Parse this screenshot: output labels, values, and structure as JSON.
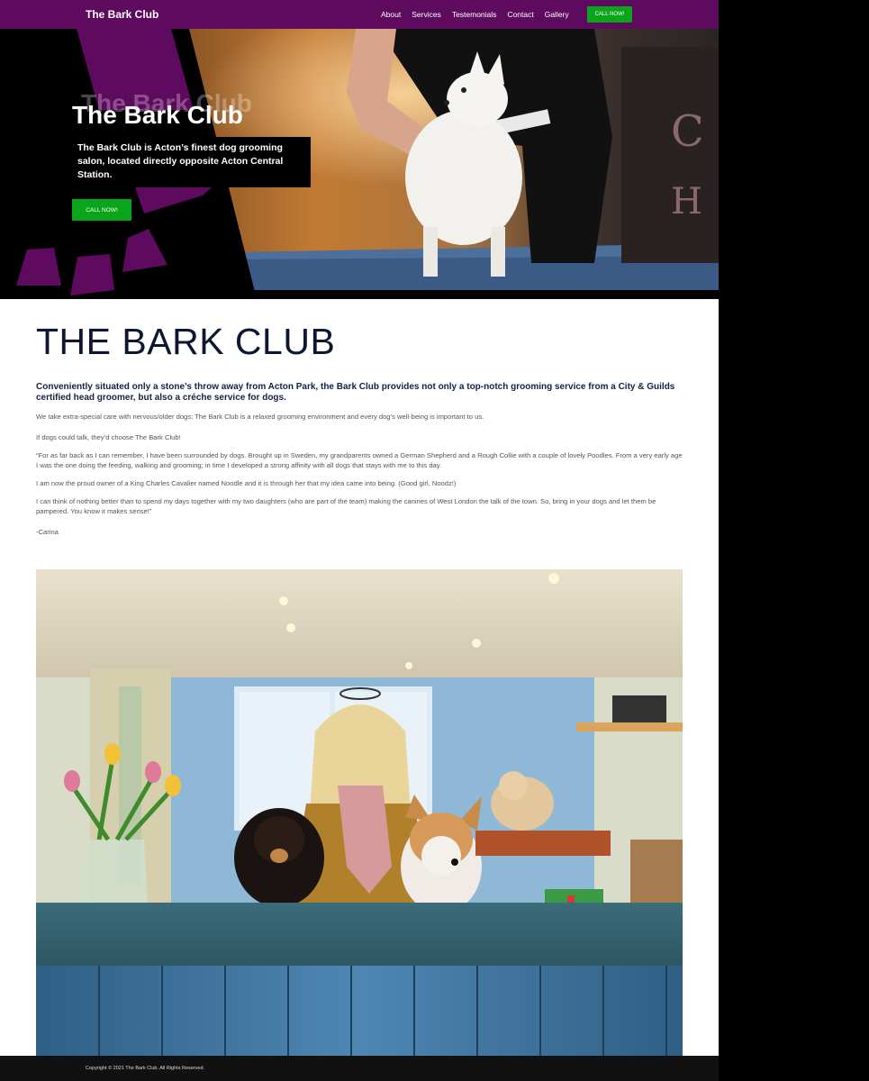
{
  "nav": {
    "brand": "The Bark Club",
    "links": [
      "About",
      "Services",
      "Testemonials",
      "Contact",
      "Gallery"
    ],
    "cta": "CALL NOW!"
  },
  "hero": {
    "title": "The Bark Club",
    "description": "The Bark Club is Acton’s finest dog grooming salon, located directly opposite Acton Central Station.",
    "cta": "CALL NOW!"
  },
  "main": {
    "heading": "THE BARK CLUB",
    "lead": "Conveniently situated only a stone’s throw away from Acton Park, the Bark Club provides not only a top-notch grooming service from a City & Guilds certified head groomer, but also a créche service for dogs.",
    "paragraphs": [
      "We take extra-special care with nervous/older dogs; The Bark Club is a relaxed grooming environment and every dog’s well-being is important to us.",
      "If dogs could talk, they’d choose The Bark Club!",
      "“For as far back as I can remember, I have been surrounded by dogs. Brought up in Sweden, my grandparents owned a German Shepherd and a Rough Collie with a couple of lovely Poodles. From a very early age I was the one doing the feeding, walking and grooming; in time I developed a strong affinity with all dogs that stays with me to this day.",
      "I am now the proud owner of a King Charles Cavalier named Noodle and it is through her that my idea came into being. (Good girl, Noodz!)",
      "I can think of nothing better than to spend my days together with my two daughters (who are part of the team) making the canines of West London the talk of the town. So, bring in your dogs and let them be pampered. You know it makes sense!”",
      "-Carina"
    ]
  },
  "footer": {
    "copyright": "Copyright © 2021 The Bark Club. All Rights Reserved."
  },
  "colors": {
    "nav_bg": "#5e0a5e",
    "cta_green": "#0aa51a",
    "heading_navy": "#0d1733"
  }
}
